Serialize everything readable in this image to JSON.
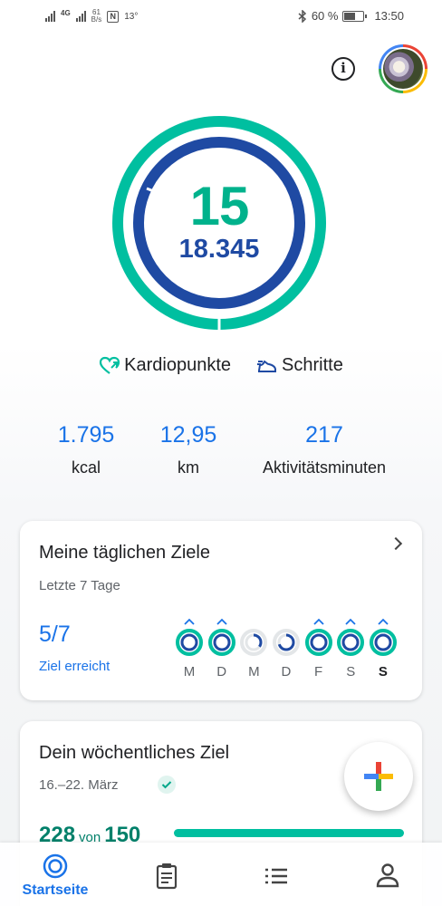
{
  "status_bar": {
    "network": "4G",
    "net_speed_value": "61",
    "net_speed_unit": "B/s",
    "temperature": "13°",
    "battery": "60 %",
    "time": "13:50"
  },
  "header": {
    "info_label": "i"
  },
  "ring": {
    "cardio_points": "15",
    "steps": "18.345",
    "cardio_goal_fraction": 1.0,
    "steps_goal_fraction": 1.0
  },
  "legend": {
    "cardio_label": "Kardiopunkte",
    "steps_label": "Schritte"
  },
  "stats": [
    {
      "value": "1.795",
      "label": "kcal"
    },
    {
      "value": "12,95",
      "label": "km"
    },
    {
      "value": "217",
      "label": "Aktivitätsminuten"
    }
  ],
  "daily_goals": {
    "title": "Meine täglichen Ziele",
    "subtitle": "Letzte 7 Tage",
    "achieved": "5/7",
    "achieved_label": "Ziel erreicht",
    "days": [
      {
        "label": "M",
        "achieved": true,
        "fraction": 1.0
      },
      {
        "label": "D",
        "achieved": true,
        "fraction": 1.0
      },
      {
        "label": "M",
        "achieved": false,
        "fraction": 0.35
      },
      {
        "label": "D",
        "achieved": false,
        "fraction": 0.7
      },
      {
        "label": "F",
        "achieved": true,
        "fraction": 1.0
      },
      {
        "label": "S",
        "achieved": true,
        "fraction": 1.0
      },
      {
        "label": "S",
        "achieved": true,
        "fraction": 1.0
      }
    ]
  },
  "weekly_goal": {
    "title": "Dein wöchentliches Ziel",
    "date_range": "16.–22. März",
    "current": "228",
    "of": "von",
    "target": "150",
    "progress_fraction": 1.0
  },
  "bottom_nav": {
    "home_label": "Startseite"
  },
  "colors": {
    "cardio": "#00bfa0",
    "steps": "#1f4aa3",
    "accent_blue": "#1a73e8"
  }
}
